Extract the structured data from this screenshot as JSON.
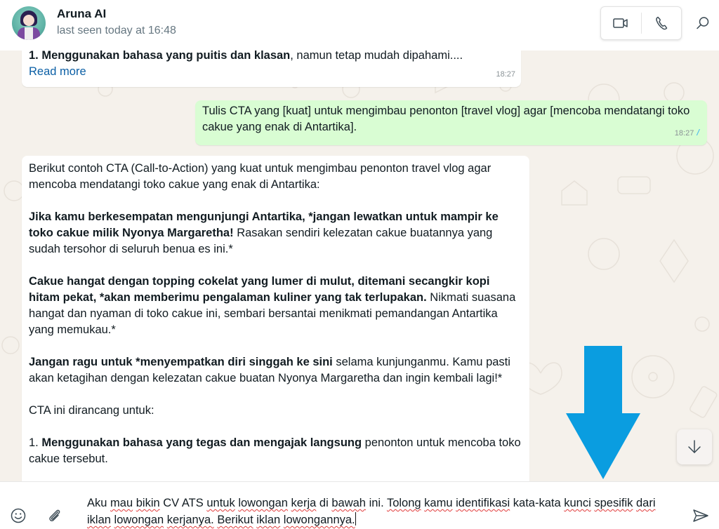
{
  "header": {
    "contact_name": "Aruna AI",
    "contact_status": "last seen today at 16:48",
    "icons": {
      "video_call": "video-camera-icon",
      "voice_call": "phone-icon",
      "search": "search-icon"
    }
  },
  "messages": [
    {
      "direction": "incoming",
      "truncated_line_bold": "1. Menggunakan bahasa yang puitis dan klasan",
      "truncated_line_rest": ", namun tetap mudah dipahami....",
      "read_more_label": "Read more",
      "time": "18:27"
    },
    {
      "direction": "outgoing",
      "text": "Tulis CTA yang [kuat] untuk mengimbau penonton [travel vlog] agar [mencoba mendatangi toko cakue yang enak di Antartika].",
      "time": "18:27",
      "status": "read",
      "status_icon": "double-check-icon"
    },
    {
      "direction": "incoming",
      "intro": "Berikut contoh CTA (Call-to-Action) yang kuat untuk mengimbau penonton travel vlog agar mencoba mendatangi toko cakue yang enak di Antartika:",
      "p1_bold": "Jika kamu berkesempatan mengunjungi Antartika, *jangan lewatkan untuk mampir ke toko cakue milik Nyonya Margaretha!",
      "p1_rest": " Rasakan sendiri kelezatan cakue buatannya yang sudah tersohor di seluruh benua es ini.*",
      "p2_bold": "Cakue hangat dengan topping cokelat yang lumer di mulut, ditemani secangkir kopi hitam pekat, *akan memberimu pengalaman kuliner yang tak terlupakan.",
      "p2_rest": " Nikmati suasana hangat dan nyaman di toko cakue ini, sembari bersantai menikmati pemandangan Antartika yang memukau.*",
      "p3_bold": "Jangan ragu untuk *menyempatkan diri singgah ke sini",
      "p3_rest": " selama kunjunganmu. Kamu pasti akan ketagihan dengan kelezatan cakue buatan Nyonya Margaretha dan ingin kembali lagi!*",
      "p4": "CTA ini dirancang untuk:",
      "p5_prefix": "1. ",
      "p5_bold": "Menggunakan bahasa yang tegas dan mengajak langsung",
      "p5_rest": " penonton untuk mencoba toko cakue tersebut."
    }
  ],
  "annotation": {
    "arrow_color": "#0a9de0",
    "arrow_direction": "down"
  },
  "scroll_down_icon": "arrow-down-icon",
  "composer": {
    "words": [
      "Aku",
      "mau",
      "bikin",
      "CV",
      "ATS",
      "untuk",
      "lowongan",
      "kerja",
      "di",
      "bawah",
      "ini.",
      "Tolong",
      "kamu",
      "identifikasi",
      "kata-kata",
      "kunci",
      "spesifik",
      "dari",
      "iklan",
      "lowongan",
      "kerjanya.",
      "Berikut",
      "iklan",
      "lowongannya."
    ],
    "misspelled": [
      false,
      true,
      true,
      false,
      false,
      true,
      true,
      true,
      false,
      true,
      false,
      true,
      true,
      true,
      false,
      true,
      true,
      true,
      true,
      true,
      true,
      true,
      true,
      true
    ],
    "icons": {
      "emoji": "smiley-icon",
      "attach": "paperclip-icon",
      "send": "send-icon"
    }
  },
  "colors": {
    "outgoing_bubble": "#d9fdd3",
    "incoming_bubble": "#ffffff",
    "read_ticks": "#53bdeb",
    "link": "#0b5fa5",
    "wallpaper": "#f5f1eb"
  }
}
